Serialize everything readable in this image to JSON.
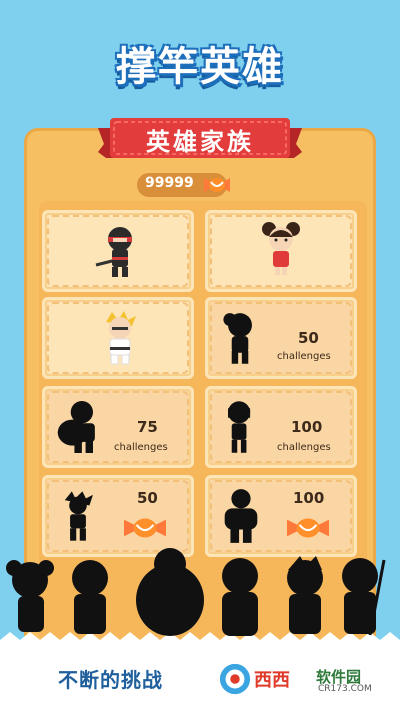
{
  "title": "撑竿英雄",
  "banner": "英雄家族",
  "coins": "99999",
  "cards": [
    {
      "row": 0,
      "col": 0,
      "state": "unlocked",
      "hero": "ninja-hero",
      "value": "",
      "label": ""
    },
    {
      "row": 0,
      "col": 1,
      "state": "unlocked",
      "hero": "girl-hero",
      "value": "",
      "label": ""
    },
    {
      "row": 1,
      "col": 0,
      "state": "unlocked",
      "hero": "karate-hero",
      "value": "",
      "label": ""
    },
    {
      "row": 1,
      "col": 1,
      "state": "locked",
      "value": "50",
      "label": "challenges"
    },
    {
      "row": 2,
      "col": 0,
      "state": "locked",
      "value": "75",
      "label": "challenges"
    },
    {
      "row": 2,
      "col": 1,
      "state": "locked",
      "value": "100",
      "label": "challenges"
    },
    {
      "row": 3,
      "col": 0,
      "state": "locked",
      "value": "50",
      "label": "candy"
    },
    {
      "row": 3,
      "col": 1,
      "state": "locked",
      "value": "100",
      "label": "candy"
    }
  ],
  "card_texts": {
    "c3_value": "50",
    "c3_label": "challenges",
    "c4_value": "75",
    "c4_label": "challenges",
    "c5_value": "100",
    "c5_label": "challenges",
    "c6_value": "50",
    "c7_value": "100"
  },
  "footer": "不断的挑战",
  "watermark": {
    "text": "西西",
    "brand": "软件园",
    "url": "CR173.COM"
  },
  "colors": {
    "background": "#7fd0ef",
    "panel": "#f6c062",
    "banner": "#e23c3c",
    "card": "#fde5b8"
  }
}
